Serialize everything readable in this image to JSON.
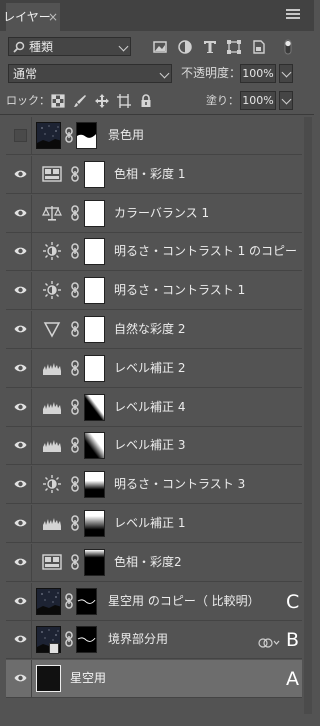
{
  "panel": {
    "tab_label": "レイヤー",
    "close_glyph": "×",
    "menu_icon": "panel-menu-icon"
  },
  "filter": {
    "kind_value": "種類",
    "icons": [
      "pixel-filter-icon",
      "adjustment-filter-icon",
      "type-filter-icon",
      "shape-filter-icon",
      "smart-object-filter-icon"
    ]
  },
  "blend": {
    "mode": "通常",
    "opacity_label": "不透明度：",
    "opacity_value": "100%"
  },
  "lock": {
    "label": "ロック：",
    "icons": [
      "lock-transparent-icon",
      "lock-paint-icon",
      "lock-position-icon",
      "lock-artboard-icon",
      "lock-all-icon"
    ],
    "fill_label": "塗り：",
    "fill_value": "100%"
  },
  "layers": [
    {
      "name": "景色用",
      "visible": false,
      "kind": "photo"
    },
    {
      "name": "色相・彩度 1",
      "visible": true,
      "kind": "hue-saturation"
    },
    {
      "name": "カラーバランス 1",
      "visible": true,
      "kind": "color-balance"
    },
    {
      "name": "明るさ・コントラスト 1 のコピー",
      "visible": true,
      "kind": "brightness-contrast"
    },
    {
      "name": "明るさ・コントラスト 1",
      "visible": true,
      "kind": "brightness-contrast"
    },
    {
      "name": "自然な彩度 2",
      "visible": true,
      "kind": "vibrance"
    },
    {
      "name": "レベル補正 2",
      "visible": true,
      "kind": "levels"
    },
    {
      "name": "レベル補正 4",
      "visible": true,
      "kind": "levels"
    },
    {
      "name": "レベル補正 3",
      "visible": true,
      "kind": "levels"
    },
    {
      "name": "明るさ・コントラスト 3",
      "visible": true,
      "kind": "brightness-contrast"
    },
    {
      "name": "レベル補正 1",
      "visible": true,
      "kind": "levels"
    },
    {
      "name": "色相・彩度2",
      "visible": true,
      "kind": "hue-saturation"
    },
    {
      "name": "星空用 のコピー（ 比較明）",
      "visible": true,
      "kind": "photo",
      "annotation": "C"
    },
    {
      "name": "境界部分用",
      "visible": true,
      "kind": "photo-smart",
      "annotation": "B"
    },
    {
      "name": "星空用",
      "visible": true,
      "kind": "photo-plain",
      "annotation": "A",
      "selected": true
    }
  ]
}
